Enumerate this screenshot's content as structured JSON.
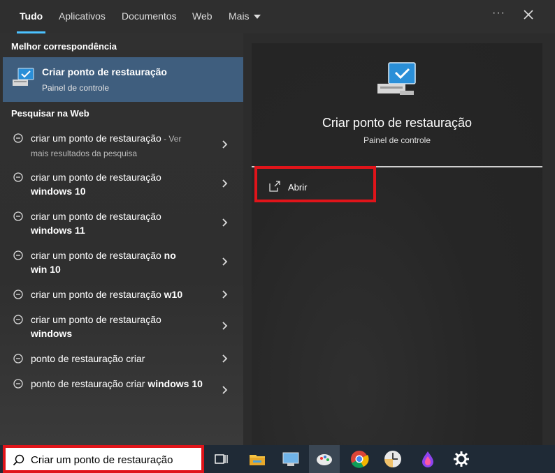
{
  "tabs": [
    {
      "label": "Tudo"
    },
    {
      "label": "Aplicativos"
    },
    {
      "label": "Documentos"
    },
    {
      "label": "Web"
    },
    {
      "label": "Mais"
    }
  ],
  "more_options": "···",
  "best_match": {
    "heading": "Melhor correspondência",
    "title": "Criar ponto de restauração",
    "subtitle": "Painel de controle"
  },
  "web_search": {
    "heading": "Pesquisar na Web",
    "items": [
      {
        "text": "criar um ponto de restauração",
        "bold": "",
        "suffix": " - Ver mais resultados da pesquisa"
      },
      {
        "text": "criar um ponto de restauração ",
        "bold": "windows 10",
        "suffix": ""
      },
      {
        "text": "criar um ponto de restauração ",
        "bold": "windows 11",
        "suffix": ""
      },
      {
        "text": "criar um ponto de restauração ",
        "bold": "no win 10",
        "suffix": ""
      },
      {
        "text": "criar um ponto de restauração ",
        "bold": "w10",
        "suffix": ""
      },
      {
        "text": "criar um ponto de restauração ",
        "bold": "windows",
        "suffix": ""
      },
      {
        "text": "ponto de restauração criar",
        "bold": "",
        "suffix": ""
      },
      {
        "text": "ponto de restauração criar ",
        "bold": "windows 10",
        "suffix": ""
      }
    ]
  },
  "preview": {
    "title": "Criar ponto de restauração",
    "subtitle": "Painel de controle",
    "action_label": "Abrir"
  },
  "search": {
    "value": "Criar um ponto de restauração"
  },
  "colors": {
    "accent": "#4cc2ff",
    "selection": "#3f5e7e",
    "highlight": "#e0141a"
  }
}
